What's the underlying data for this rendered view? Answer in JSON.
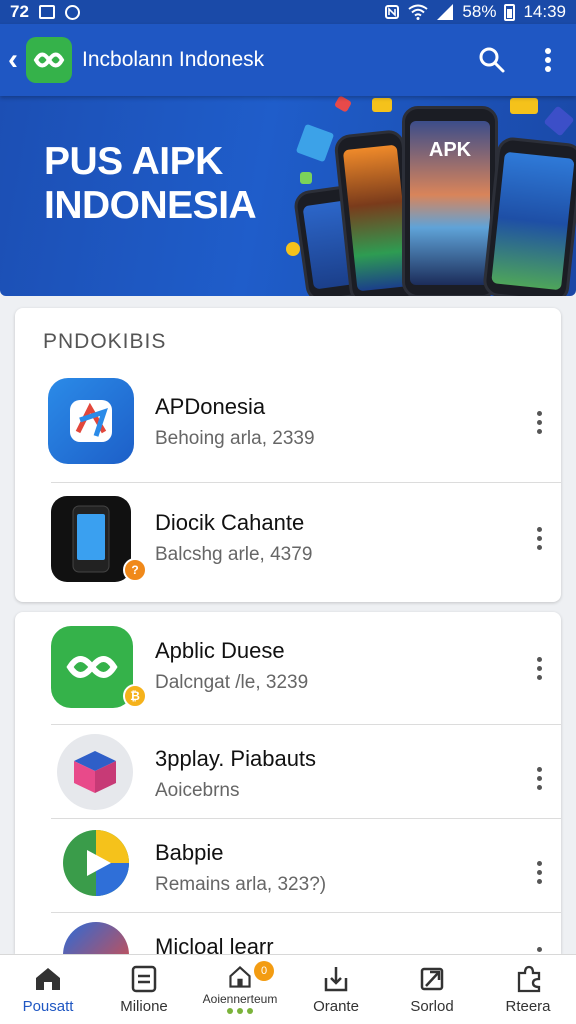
{
  "status_bar": {
    "left_text": "72",
    "battery": "58%",
    "time": "14:39"
  },
  "app_bar": {
    "title": "Incbolann Indonesk",
    "icons": [
      "back-icon",
      "app-logo-icon",
      "search-icon",
      "more-vert-icon"
    ]
  },
  "banner": {
    "headline_line1": "PUS AIPK",
    "headline_line2": "INDONESIA",
    "phone_screen_text": "APK"
  },
  "section1": {
    "title": "PNDOKIBIS",
    "items": [
      {
        "name": "APDonesia",
        "sub": "Behoing arla,  2339",
        "icon": "apdonesia-icon"
      },
      {
        "name": "Diocik Cahante",
        "sub": "Balcshg arle,  4379",
        "icon": "phone-icon",
        "badge": "?"
      }
    ]
  },
  "section2": {
    "items": [
      {
        "name": "Apblic Duese",
        "sub": "Dalcngat /le,  3239",
        "icon": "apblic-icon",
        "badge": "₿"
      },
      {
        "name": "3pplay. Piabauts",
        "sub": "Aoicebrns",
        "icon": "cube-icon"
      },
      {
        "name": "Babpie",
        "sub": "Remains arla,  323?)",
        "icon": "play-triangle-icon"
      },
      {
        "name": "Micloal learr",
        "sub": "",
        "icon": "swirl-icon"
      }
    ]
  },
  "bottom_nav": {
    "items": [
      {
        "label": "Pousatt",
        "icon": "home-icon",
        "active": true
      },
      {
        "label": "Milione",
        "icon": "list-icon"
      },
      {
        "label": "Aoiennerteum",
        "icon": "house-outline-icon",
        "badge": "0"
      },
      {
        "label": "Orante",
        "icon": "download-icon"
      },
      {
        "label": "Sorlod",
        "icon": "flag-icon"
      },
      {
        "label": "Rteera",
        "icon": "puzzle-icon"
      }
    ]
  },
  "colors": {
    "primary": "#1f57c3",
    "status_bar": "#1a4aa8",
    "brand_green": "#35b24a",
    "badge_orange": "#f0891a"
  }
}
